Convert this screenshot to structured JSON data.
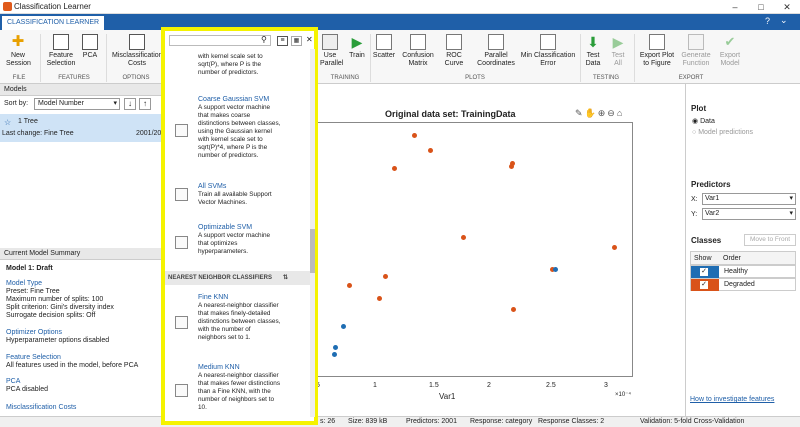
{
  "window": {
    "title": "Classification Learner",
    "tab": "CLASSIFICATION LEARNER"
  },
  "ribbon": {
    "buttons": [
      {
        "label": "New\nSession",
        "id": "new"
      },
      {
        "label": "Feature\nSelection",
        "id": "feat"
      },
      {
        "label": "PCA",
        "id": "pca"
      },
      {
        "label": "Misclassification\nCosts",
        "id": "misc"
      },
      {
        "label": "Use\nParallel",
        "id": "par"
      },
      {
        "label": "Train",
        "id": "train"
      },
      {
        "label": "Scatter",
        "id": "scatter"
      },
      {
        "label": "Confusion\nMatrix",
        "id": "conf"
      },
      {
        "label": "ROC\nCurve",
        "id": "roc"
      },
      {
        "label": "Parallel\nCoordinates",
        "id": "pc"
      },
      {
        "label": "Min Classification\nError",
        "id": "mce"
      },
      {
        "label": "Test\nData",
        "id": "test"
      },
      {
        "label": "Test\nAll",
        "id": "testall"
      },
      {
        "label": "Export Plot\nto Figure",
        "id": "exp"
      },
      {
        "label": "Generate\nFunction",
        "id": "gen"
      },
      {
        "label": "Export\nModel",
        "id": "expm"
      }
    ],
    "sections": [
      "FILE",
      "FEATURES",
      "OPTIONS",
      "TRAINING",
      "PLOTS",
      "TESTING",
      "EXPORT"
    ]
  },
  "models": {
    "header": "Models",
    "sort_label": "Sort by:",
    "sort_value": "Model Number",
    "item_name": "1  Tree",
    "item_change": "Last change: Fine Tree",
    "item_date": "2001/20"
  },
  "summary": {
    "header": "Current Model Summary",
    "title": "Model 1: Draft",
    "model_type": "Model Type",
    "lines1": [
      "Preset: Fine Tree",
      "Maximum number of splits: 100",
      "Split criterion: Gini's diversity index",
      "Surrogate decision splits: Off"
    ],
    "opt": "Optimizer Options",
    "opt_line": "Hyperparameter options disabled",
    "fs": "Feature Selection",
    "fs_line": "All features used in the model, before PCA",
    "pca": "PCA",
    "pca_line": "PCA disabled",
    "mc": "Misclassification Costs"
  },
  "gallery": {
    "top_desc": "with kernel scale set to\nsqrt(P), where P is the\nnumber of predictors.",
    "items": [
      {
        "name": "Coarse Gaussian SVM",
        "desc": "A support vector machine\nthat makes coarse\ndistinctions between classes,\nusing the Gaussian kernel\nwith kernel scale set to\nsqrt(P)*4, where P is the\nnumber of predictors."
      },
      {
        "name": "All SVMs",
        "desc": "Train all available Support\nVector Machines."
      },
      {
        "name": "Optimizable SVM",
        "desc": "A support vector machine\nthat optimizes\nhyperparameters."
      },
      {
        "name": "Fine KNN",
        "desc": "A nearest-neighbor classifier\nthat makes finely-detailed\ndistinctions between classes,\nwith the number of\nneighbors set to 1."
      },
      {
        "name": "Medium KNN",
        "desc": "A nearest-neighbor classifier\nthat makes fewer distinctions\nthan a Fine KNN, with the\nnumber of neighbors set to\n10."
      }
    ],
    "section": "NEAREST NEIGHBOR CLASSIFIERS"
  },
  "plot": {
    "title": "Original data set: TrainingData",
    "xlabel": "Var1",
    "ticks": [
      "5",
      "1",
      "1.5",
      "2",
      "2.5",
      "3"
    ],
    "exp": "×10⁻⁴"
  },
  "right": {
    "plot": "Plot",
    "data": "Data",
    "preds": "Model predictions",
    "predictors": "Predictors",
    "x_label": "X:",
    "x_val": "Var1",
    "y_label": "Y:",
    "y_val": "Var2",
    "classes": "Classes",
    "move_front": "Move to Front",
    "show": "Show",
    "order": "Order",
    "c1": "Healthy",
    "c2": "Degraded",
    "link": "How to investigate features"
  },
  "status": {
    "s1": "s: 26",
    "s2": "Size: 839 kB",
    "s3": "Predictors: 2001",
    "s4": "Response: category",
    "s5": "Response Classes: 2",
    "s6": "Validation: 5-fold Cross-Validation"
  },
  "colors": {
    "healthy": "#1f6db3",
    "degraded": "#d95319",
    "highlight": "#f5f300"
  }
}
